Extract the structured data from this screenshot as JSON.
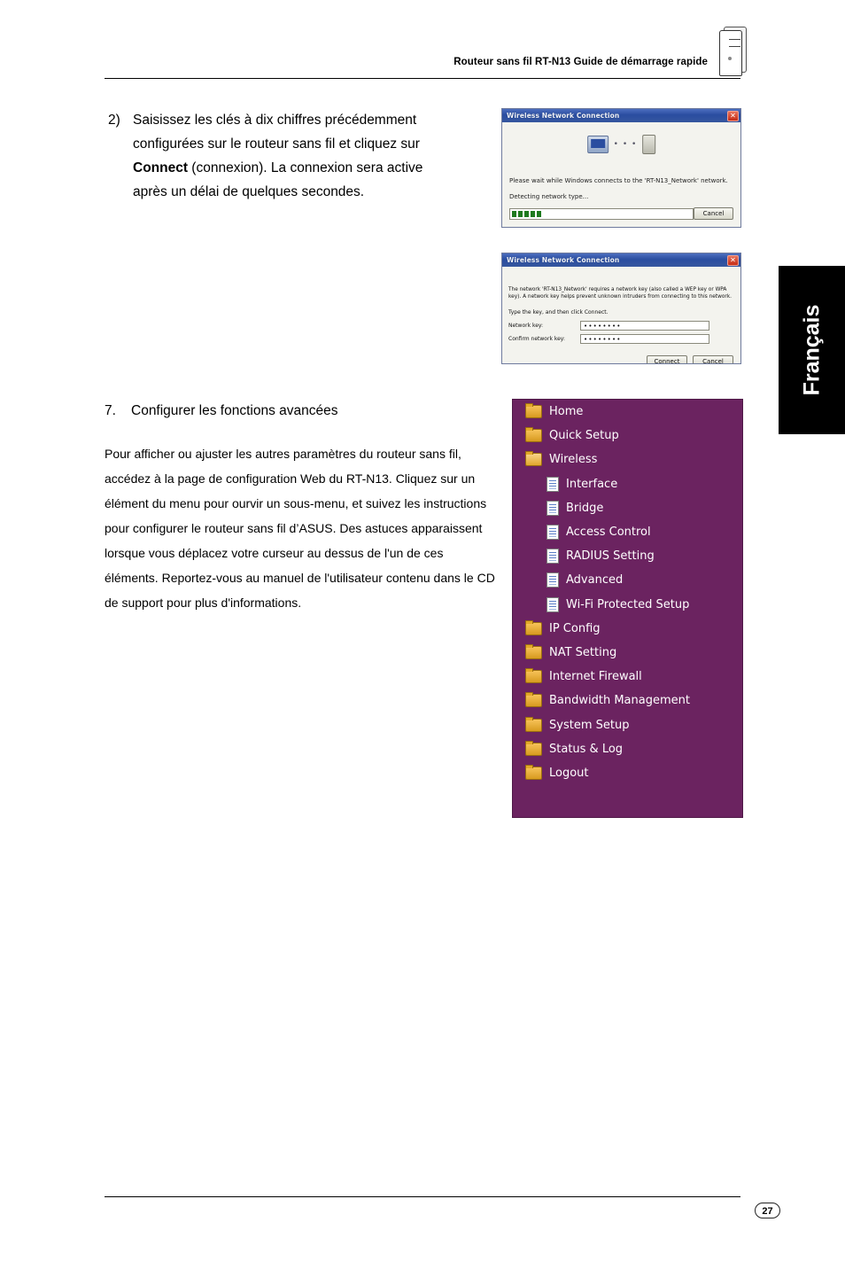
{
  "header": {
    "title": "Routeur sans fil RT-N13 Guide de démarrage rapide"
  },
  "side_tab": {
    "label": "Français"
  },
  "step2": {
    "number": "2)",
    "text_before": "Saisissez les clés à dix chiffres précédemment configurées sur le routeur sans fil et cliquez sur ",
    "bold": "Connect",
    "text_after": " (connexion). La connexion sera active après un délai de quelques secondes."
  },
  "section7": {
    "number": "7.",
    "title": "Configurer les fonctions avancées",
    "body": "Pour afficher ou ajuster les autres paramètres du routeur sans fil, accédez à la page de configuration Web du RT-N13. Cliquez sur un élément du menu pour ourvir un sous-menu, et suivez les instructions pour configurer le routeur sans fil d’ASUS. Des astuces apparaissent lorsque vous déplacez votre curseur au dessus de l'un de ces éléments. Reportez-vous au manuel de l'utilisateur contenu dans le CD de support pour plus d'informations."
  },
  "dialog_connecting": {
    "title": "Wireless Network Connection",
    "close_label": "✕",
    "status_line": "Please wait while Windows connects to the 'RT-N13_Network' network.",
    "detecting_line": "Detecting network type...",
    "cancel_button": "Cancel"
  },
  "dialog_key": {
    "title": "Wireless Network Connection",
    "close_label": "✕",
    "paragraph": "The network 'RT-N13_Network' requires a network key (also called a WEP key or WPA key). A network key helps prevent unknown intruders from connecting to this network.",
    "instruction": "Type the key, and then click Connect.",
    "field1_label": "Network key:",
    "field1_value": "••••••••",
    "field2_label": "Confirm network key:",
    "field2_value": "••••••••",
    "connect_button": "Connect",
    "cancel_button": "Cancel"
  },
  "router_menu": {
    "items": [
      {
        "label": "Home",
        "icon": "folder-icon",
        "level": 0
      },
      {
        "label": "Quick Setup",
        "icon": "folder-icon",
        "level": 0
      },
      {
        "label": "Wireless",
        "icon": "folder-open-icon",
        "level": 0
      },
      {
        "label": "Interface",
        "icon": "page-icon",
        "level": 1
      },
      {
        "label": "Bridge",
        "icon": "page-icon",
        "level": 1
      },
      {
        "label": "Access Control",
        "icon": "page-icon",
        "level": 1
      },
      {
        "label": "RADIUS Setting",
        "icon": "page-icon",
        "level": 1
      },
      {
        "label": "Advanced",
        "icon": "page-icon",
        "level": 1
      },
      {
        "label": "Wi-Fi Protected Setup",
        "icon": "page-icon",
        "level": 1
      },
      {
        "label": "IP Config",
        "icon": "folder-icon",
        "level": 0
      },
      {
        "label": "NAT Setting",
        "icon": "folder-icon",
        "level": 0
      },
      {
        "label": "Internet Firewall",
        "icon": "folder-icon",
        "level": 0
      },
      {
        "label": "Bandwidth Management",
        "icon": "folder-icon",
        "level": 0
      },
      {
        "label": "System Setup",
        "icon": "folder-icon",
        "level": 0
      },
      {
        "label": "Status & Log",
        "icon": "folder-icon",
        "level": 0
      },
      {
        "label": "Logout",
        "icon": "folder-icon",
        "level": 0
      }
    ],
    "background_color": "#6b2360"
  },
  "footer": {
    "page_number": "27"
  }
}
